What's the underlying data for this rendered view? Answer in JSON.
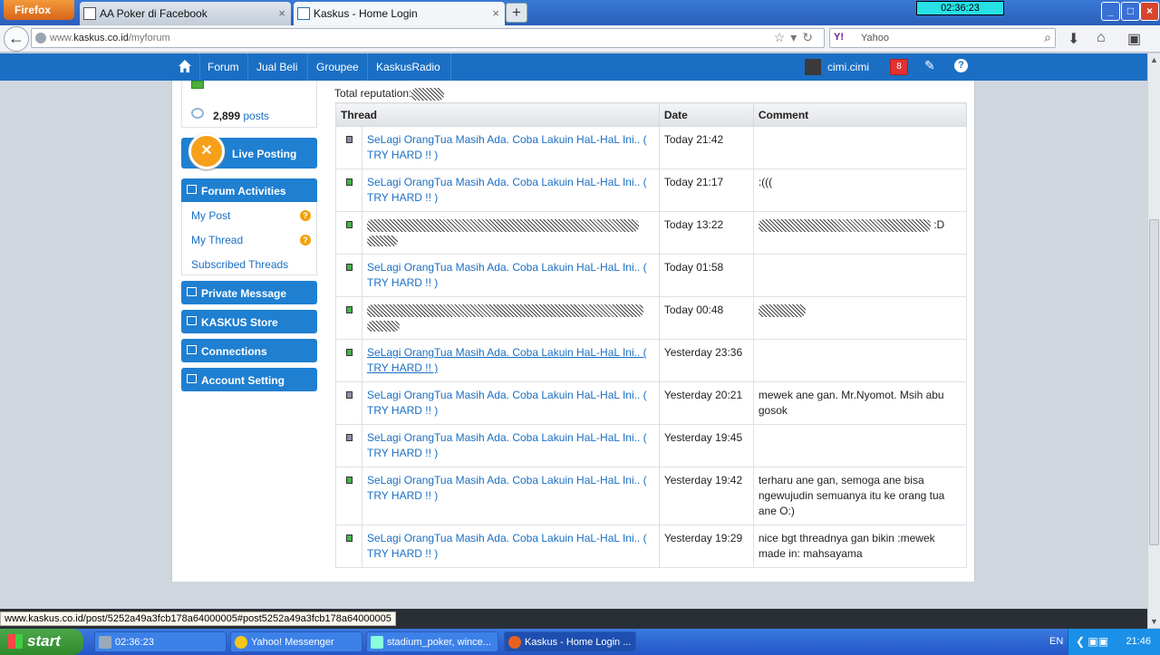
{
  "browser": {
    "menu_button": "Firefox",
    "tabs": [
      {
        "title": "AA Poker di Facebook",
        "active": false
      },
      {
        "title": "Kaskus - Home Login",
        "active": true
      }
    ],
    "clock": "02:36:23",
    "url_prefix": "www.",
    "url_domain": "kaskus.co.id",
    "url_path": "/myforum",
    "search_engine": "Y!",
    "search_placeholder": "Yahoo"
  },
  "site_nav": {
    "links": [
      "Forum",
      "Jual Beli",
      "Groupee",
      "KaskusRadio"
    ],
    "username": "cimi.cimi",
    "notification_count": "8",
    "help": "?"
  },
  "sidebar": {
    "posts_count": "2,899",
    "posts_label": "posts",
    "live_posting": "Live Posting",
    "forum_activities": "Forum Activities",
    "activity_links": [
      "My Post",
      "My Thread",
      "Subscribed Threads"
    ],
    "badge_mark": "?",
    "private_message": "Private Message",
    "kaskus_store": "KASKUS Store",
    "connections": "Connections",
    "account_setting": "Account Setting"
  },
  "main": {
    "total_reputation_label": "Total reputation:",
    "columns": [
      "Thread",
      "Date",
      "Comment"
    ],
    "rows": [
      {
        "status": "grey",
        "thread": "SeLagi OrangTua Masih Ada. Coba Lakuin HaL-HaL Ini.. ( TRY HARD !! )",
        "date": "Today 21:42",
        "comment": ""
      },
      {
        "status": "green",
        "thread": "SeLagi OrangTua Masih Ada. Coba Lakuin HaL-HaL Ini.. ( TRY HARD !! )",
        "date": "Today 21:17",
        "comment": ":((("
      },
      {
        "status": "green",
        "thread": "",
        "date": "Today 13:22",
        "comment": ":D"
      },
      {
        "status": "green",
        "thread": "SeLagi OrangTua Masih Ada. Coba Lakuin HaL-HaL Ini.. ( TRY HARD !! )",
        "date": "Today 01:58",
        "comment": ""
      },
      {
        "status": "green",
        "thread": "",
        "date": "Today 00:48",
        "comment": ""
      },
      {
        "status": "green",
        "thread": "SeLagi OrangTua Masih Ada. Coba Lakuin HaL-HaL Ini.. ( TRY HARD !! )",
        "date": "Yesterday 23:36",
        "comment": ""
      },
      {
        "status": "grey",
        "thread": "SeLagi OrangTua Masih Ada. Coba Lakuin HaL-HaL Ini.. ( TRY HARD !! )",
        "date": "Yesterday 20:21",
        "comment": "mewek ane gan. Mr.Nyomot. Msih abu gosok"
      },
      {
        "status": "grey",
        "thread": "SeLagi OrangTua Masih Ada. Coba Lakuin HaL-HaL Ini.. ( TRY HARD !! )",
        "date": "Yesterday 19:45",
        "comment": ""
      },
      {
        "status": "green",
        "thread": "SeLagi OrangTua Masih Ada. Coba Lakuin HaL-HaL Ini.. ( TRY HARD !! )",
        "date": "Yesterday 19:42",
        "comment": "terharu ane gan, semoga ane bisa ngewujudin semuanya itu ke orang tua ane O:)"
      },
      {
        "status": "green",
        "thread": "SeLagi OrangTua Masih Ada. Coba Lakuin HaL-HaL Ini.. ( TRY HARD !! )",
        "date": "Yesterday 19:29",
        "comment": "nice bgt threadnya gan bikin :mewek made in: mahsayama"
      }
    ]
  },
  "status_bar_url": "www.kaskus.co.id/post/5252a49a3fcb178a64000005#post5252a49a3fcb178a64000005",
  "taskbar": {
    "start": "start",
    "items": [
      "02:36:23",
      "Yahoo! Messenger",
      "stadium_poker, wince...",
      "Kaskus - Home Login ..."
    ],
    "language": "EN",
    "time": "21:46"
  }
}
